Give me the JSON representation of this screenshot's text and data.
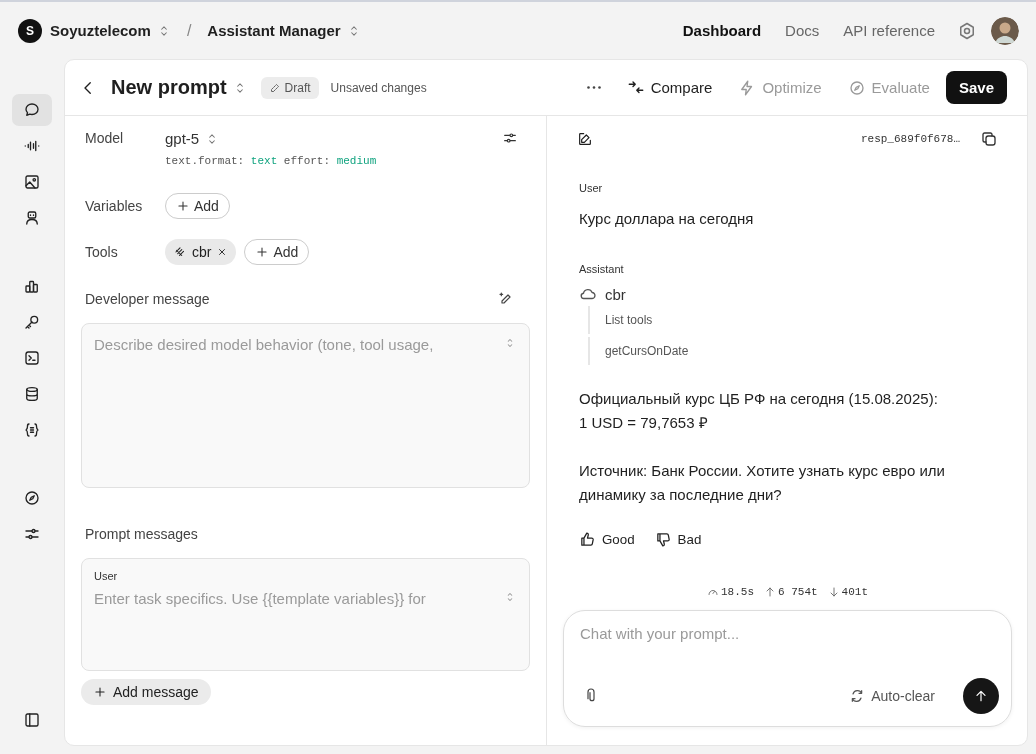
{
  "org": {
    "initial": "S",
    "name": "Soyuztelecom"
  },
  "breadcrumb_separator": "/",
  "project": {
    "name": "Assistant Manager"
  },
  "nav": [
    {
      "label": "Dashboard",
      "selected": true
    },
    {
      "label": "Docs",
      "selected": false
    },
    {
      "label": "API reference",
      "selected": false
    }
  ],
  "sidebar": {
    "groups": [
      [
        {
          "kind": "chat",
          "selected": true
        },
        {
          "kind": "audio",
          "selected": false
        },
        {
          "kind": "image",
          "selected": false
        },
        {
          "kind": "bot",
          "selected": false
        }
      ],
      [
        {
          "kind": "chart",
          "selected": false
        },
        {
          "kind": "key",
          "selected": false
        },
        {
          "kind": "terminal",
          "selected": false
        },
        {
          "kind": "database",
          "selected": false
        },
        {
          "kind": "braces",
          "selected": false
        }
      ],
      [
        {
          "kind": "compass",
          "selected": false
        },
        {
          "kind": "sliders",
          "selected": false
        }
      ]
    ]
  },
  "prompt": {
    "title": "New prompt",
    "status": "Draft",
    "note": "Unsaved changes"
  },
  "actions": [
    {
      "kind": "compare",
      "label": "Compare",
      "disabled": false
    },
    {
      "kind": "optimize",
      "label": "Optimize",
      "disabled": true
    },
    {
      "kind": "evaluate",
      "label": "Evaluate",
      "disabled": true
    }
  ],
  "save_button": "Save",
  "model": {
    "label": "Model",
    "name": "gpt-5",
    "params": [
      {
        "key": "text.format:",
        "value": "text"
      },
      {
        "key": "effort:",
        "value": "medium"
      }
    ]
  },
  "variables": {
    "label": "Variables",
    "add_button": "Add"
  },
  "tools": {
    "label": "Tools",
    "chips": [
      {
        "name": "cbr"
      }
    ],
    "add_button": "Add"
  },
  "developer_message": {
    "label": "Developer message",
    "placeholder": "Describe desired model behavior (tone, tool usage,"
  },
  "prompt_messages": {
    "label": "Prompt messages",
    "messages": [
      {
        "role": "User",
        "placeholder": "Enter task specifics. Use {{template variables}} for"
      }
    ],
    "add_button": "Add message"
  },
  "response": {
    "id": "resp_689f0f678…"
  },
  "conversation": [
    {
      "kind": "user",
      "role": "User",
      "text": "Курс доллара на сегодня"
    },
    {
      "kind": "assistant",
      "role": "Assistant",
      "tool": "cbr",
      "calls": [
        "List tools",
        "getCursOnDate"
      ],
      "paragraphs": [
        "Официальный курс ЦБ РФ на сегодня (15.08.2025):\n1 USD = 79,7653 ₽",
        "Источник: Банк России. Хотите узнать курс евро или динамику за последние дни?"
      ]
    }
  ],
  "feedback": [
    {
      "kind": "good",
      "label": "Good"
    },
    {
      "kind": "bad",
      "label": "Bad"
    }
  ],
  "stats": [
    {
      "kind": "time",
      "text": "18.5s"
    },
    {
      "kind": "input",
      "text": "6 754t"
    },
    {
      "kind": "output",
      "text": "401t"
    }
  ],
  "chat_input": {
    "placeholder": "Chat with your prompt...",
    "auto_clear": "Auto-clear"
  }
}
